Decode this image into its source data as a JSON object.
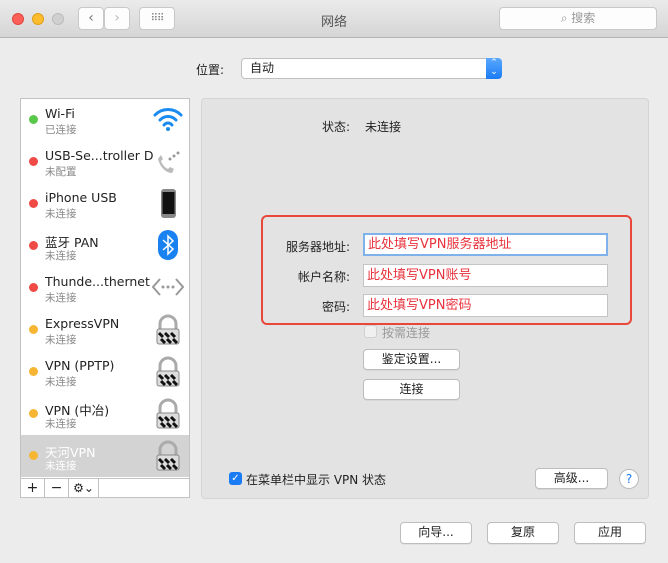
{
  "window": {
    "title": "网络",
    "search_placeholder": "搜索"
  },
  "location": {
    "label": "位置:",
    "value": "自动"
  },
  "services": [
    {
      "name": "Wi-Fi",
      "status": "已连接",
      "dot": "#5ac84a",
      "icon": "wifi-icon"
    },
    {
      "name": "USB-Se...troller D",
      "status": "未配置",
      "dot": "#ef4a46",
      "icon": "phone-icon"
    },
    {
      "name": "iPhone USB",
      "status": "未连接",
      "dot": "#ef4a46",
      "icon": "iphone-icon"
    },
    {
      "name": "蓝牙 PAN",
      "status": "未连接",
      "dot": "#ef4a46",
      "icon": "bluetooth-icon"
    },
    {
      "name": "Thunde...thernet",
      "status": "未连接",
      "dot": "#ef4a46",
      "icon": "ethernet-icon"
    },
    {
      "name": "ExpressVPN",
      "status": "未连接",
      "dot": "#f6b532",
      "icon": "lock-icon"
    },
    {
      "name": "VPN (PPTP)",
      "status": "未连接",
      "dot": "#f6b532",
      "icon": "lock-icon"
    },
    {
      "name": "VPN (中冶)",
      "status": "未连接",
      "dot": "#f6b532",
      "icon": "lock-icon"
    },
    {
      "name": "天河VPN",
      "status": "未连接",
      "dot": "#f6b532",
      "icon": "lock-icon",
      "selected": true
    }
  ],
  "list_toolbar": {
    "add": "+",
    "remove": "−",
    "gear": "⚙⌄"
  },
  "detail": {
    "status_label": "状态:",
    "status_value": "未连接",
    "server_label": "服务器地址:",
    "server_value": "此处填写VPN服务器地址",
    "account_label": "帐户名称:",
    "account_value": "此处填写VPN账号",
    "password_label": "密码:",
    "password_value": "此处填写VPN密码",
    "on_demand_label": "按需连接",
    "on_demand_checked": false,
    "auth_button": "鉴定设置...",
    "connect_button": "连接",
    "show_status_label": "在菜单栏中显示 VPN 状态",
    "show_status_checked": true,
    "advanced_button": "高级...",
    "help_button": "?"
  },
  "footer": {
    "assist": "向导...",
    "revert": "复原",
    "apply": "应用"
  }
}
